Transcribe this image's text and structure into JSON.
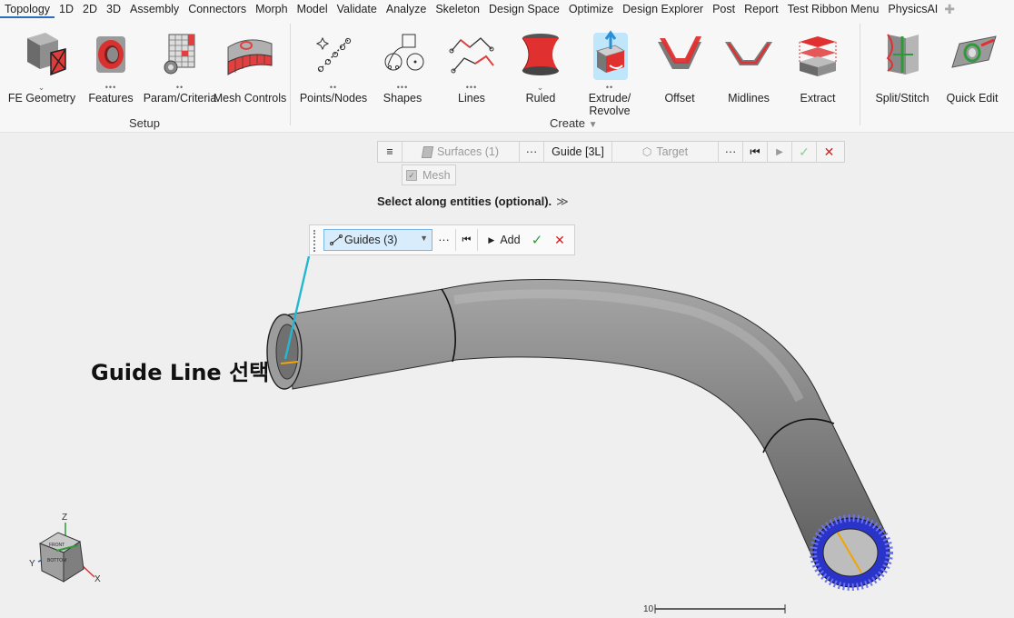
{
  "menubar": {
    "tabs": [
      "Topology",
      "1D",
      "2D",
      "3D",
      "Assembly",
      "Connectors",
      "Morph",
      "Model",
      "Validate",
      "Analyze",
      "Skeleton",
      "Design Space",
      "Optimize",
      "Design Explorer",
      "Post",
      "Report",
      "Test Ribbon Menu",
      "PhysicsAI"
    ],
    "add_icon": "plus-icon"
  },
  "ribbon": {
    "setup": {
      "label": "Setup",
      "buttons": {
        "fe_geometry": "FE Geometry",
        "features": "Features",
        "param_criteria": "Param/Criteria",
        "mesh_controls": "Mesh Controls"
      }
    },
    "create": {
      "label": "Create",
      "buttons": {
        "points_nodes": "Points/Nodes",
        "shapes": "Shapes",
        "lines": "Lines",
        "ruled": "Ruled",
        "extrude_revolve_1": "Extrude/",
        "extrude_revolve_2": "Revolve",
        "offset": "Offset",
        "midlines": "Midlines",
        "extract": "Extract"
      }
    },
    "edit": {
      "buttons": {
        "split_stitch": "Split/Stitch",
        "quick_edit": "Quick Edit"
      }
    }
  },
  "selection_toolbar": {
    "menu_icon": "≡",
    "surfaces": "Surfaces (1)",
    "more1": "···",
    "guide": "Guide [3L]",
    "target": "Target",
    "more2": "···",
    "mesh": "Mesh"
  },
  "prompt": {
    "text": "Select along entities (optional).",
    "chevron": "≫"
  },
  "guides_toolbar": {
    "guides": "Guides (3)",
    "more": "···",
    "add": "Add"
  },
  "annotation": "Guide Line 선택",
  "viewport": {
    "axes": {
      "z": "Z",
      "y": "Y",
      "x": "X"
    },
    "cube_top": "FRONT",
    "cube_side": "BOTTOM",
    "scale_label": "10"
  },
  "colors": {
    "tab_underline": "#2a6ebd",
    "guide_highlight": "#d9ecfb",
    "pipe": "#8a8a8a",
    "leader_line": "#22b8cf",
    "confirm": "#2e9a3a",
    "cancel": "#d21f1f",
    "mesh_blue": "#2b34c8",
    "guide_line": "#f0a500"
  }
}
